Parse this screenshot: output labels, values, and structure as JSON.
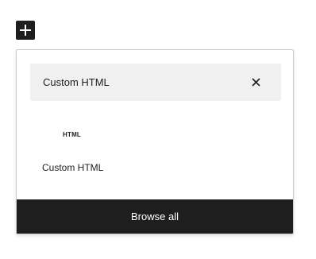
{
  "toolbar": {
    "add_block_icon": "plus-icon"
  },
  "inserter": {
    "search": {
      "value": "Custom HTML",
      "clear_icon": "close-icon"
    },
    "results": [
      {
        "icon_text": "HTML",
        "title": "Custom HTML"
      }
    ],
    "browse_all_label": "Browse all"
  },
  "colors": {
    "dark": "#1e1e1e",
    "search_bg": "#f0f0f0",
    "border": "#cccccc"
  }
}
